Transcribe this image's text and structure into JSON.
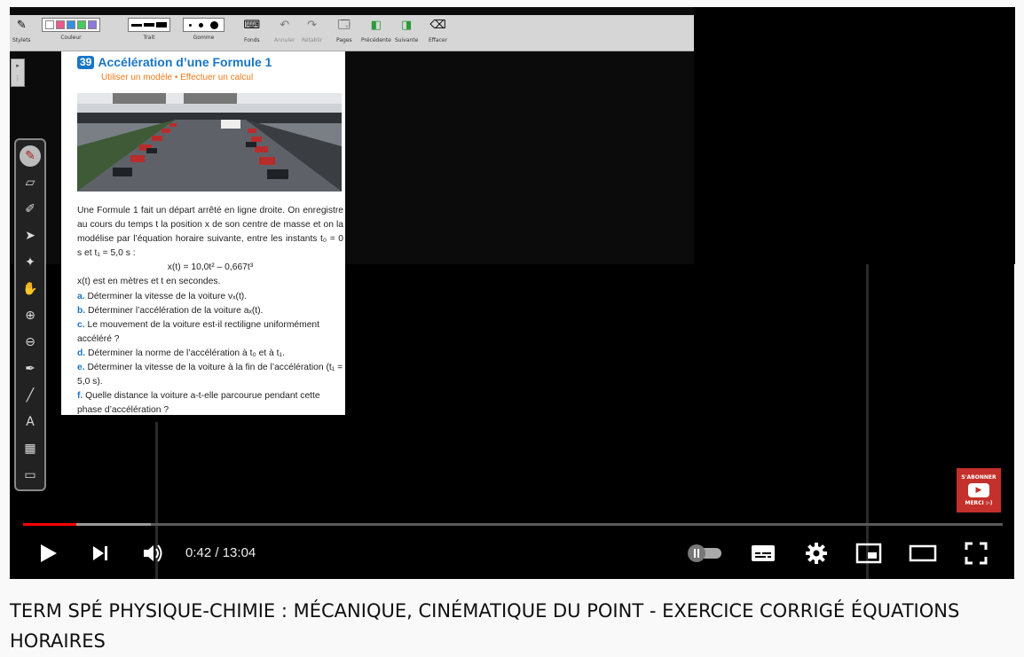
{
  "toolbar": {
    "groups": [
      {
        "label": "Stylets"
      },
      {
        "label": "Couleur"
      },
      {
        "label": "Trait"
      },
      {
        "label": "Gomme"
      },
      {
        "label": "Fonds"
      },
      {
        "label": "Annuler"
      },
      {
        "label": "Rétablir"
      },
      {
        "label": "Pages"
      },
      {
        "label": "Précédente"
      },
      {
        "label": "Suivante"
      },
      {
        "label": "Effacer"
      }
    ],
    "colors": [
      "#ffffff",
      "#e85a8c",
      "#3a8ee0",
      "#4cc760",
      "#8b7ad8"
    ]
  },
  "side_tools": [
    "pen-icon",
    "eraser-icon",
    "highlighter-icon",
    "pointer-icon",
    "magic-wand-icon",
    "hand-icon",
    "zoom-in-icon",
    "zoom-out-icon",
    "color-picker-icon",
    "line-icon",
    "text-icon",
    "background-icon",
    "screen-icon"
  ],
  "exercise": {
    "number": "39",
    "title": "Accélération d’une Formule 1",
    "subtitle": "Utiliser un modèle • Effectuer un calcul",
    "intro": "Une Formule 1 fait un départ arrêté en ligne droite. On enregistre au cours du temps t la position x de son centre de masse et on la modélise par l’équation horaire suivante, entre les instants t₀ = 0 s et t₁ = 5,0 s :",
    "equation": "x(t) = 10,0t² – 0,667t³",
    "units": "x(t) est en mètres et t en secondes.",
    "questions": [
      {
        "letter": "a.",
        "text": "Déterminer la vitesse de la voiture vₓ(t)."
      },
      {
        "letter": "b.",
        "text": "Déterminer l’accélération de la voiture aₓ(t)."
      },
      {
        "letter": "c.",
        "text": "Le mouvement de la voiture est-il rectiligne uniformément accéléré ?"
      },
      {
        "letter": "d.",
        "text": "Déterminer la norme de l’accélération à t₀ et à t₁."
      },
      {
        "letter": "e.",
        "text": "Déterminer la vitesse de la voiture à la fin de l’accélération (t₁ = 5,0 s)."
      },
      {
        "letter": "f.",
        "text": "Quelle distance la voiture a-t-elle parcourue pendant cette phase d’accélération ?"
      }
    ]
  },
  "subscribe": {
    "line1": "S'ABONNER",
    "line2": "MERCI :-)"
  },
  "player": {
    "current_time": "0:42",
    "separator": " / ",
    "duration": "13:04",
    "progress": 0.054,
    "buffered": 0.13,
    "accent": "#ff0000"
  },
  "video_title": "TERM SPÉ PHYSIQUE-CHIMIE : MÉCANIQUE, CINÉMATIQUE DU POINT - EXERCICE CORRIGÉ ÉQUATIONS HORAIRES"
}
